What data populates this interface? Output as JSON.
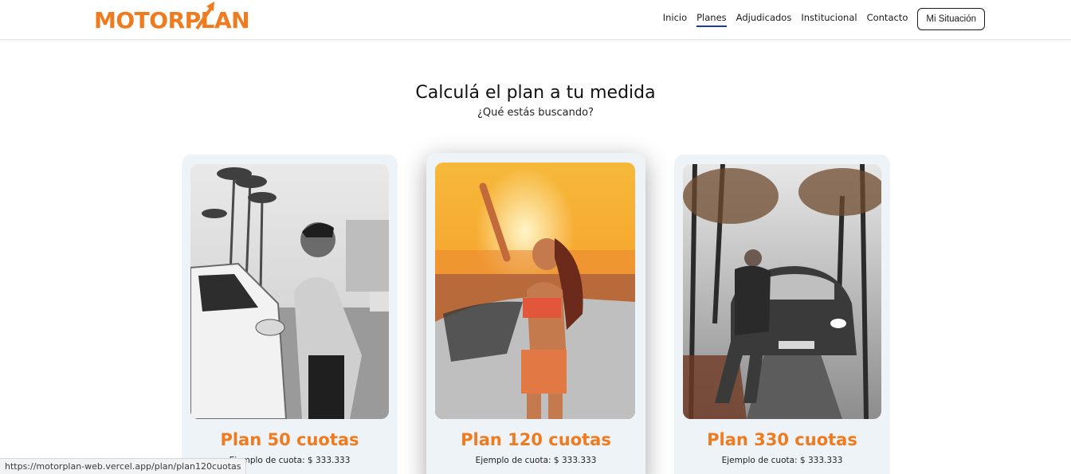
{
  "brand": {
    "logo_text": "MOTORPLAN",
    "accent_color": "#f07a1e"
  },
  "nav": {
    "items": [
      {
        "label": "Inicio",
        "active": false
      },
      {
        "label": "Planes",
        "active": true
      },
      {
        "label": "Adjudicados",
        "active": false
      },
      {
        "label": "Institucional",
        "active": false
      },
      {
        "label": "Contacto",
        "active": false
      }
    ],
    "cta_label": "Mi Situación",
    "active_underline_color": "#1f3f8a"
  },
  "hero": {
    "title": "Calculá el plan a tu medida",
    "subtitle": "¿Qué estás buscando?"
  },
  "plans": [
    {
      "title": "Plan 50 cuotas",
      "example": "Ejemplo de cuota: $ 333.333",
      "image_icon": "man-at-car-photo"
    },
    {
      "title": "Plan 120 cuotas",
      "example": "Ejemplo de cuota: $ 333.333",
      "image_icon": "woman-sunset-car-photo"
    },
    {
      "title": "Plan 330 cuotas",
      "example": "Ejemplo de cuota: $ 333.333",
      "image_icon": "man-leaning-car-photo"
    }
  ],
  "status_bar": {
    "url": "https://motorplan-web.vercel.app/plan/plan120cuotas"
  }
}
